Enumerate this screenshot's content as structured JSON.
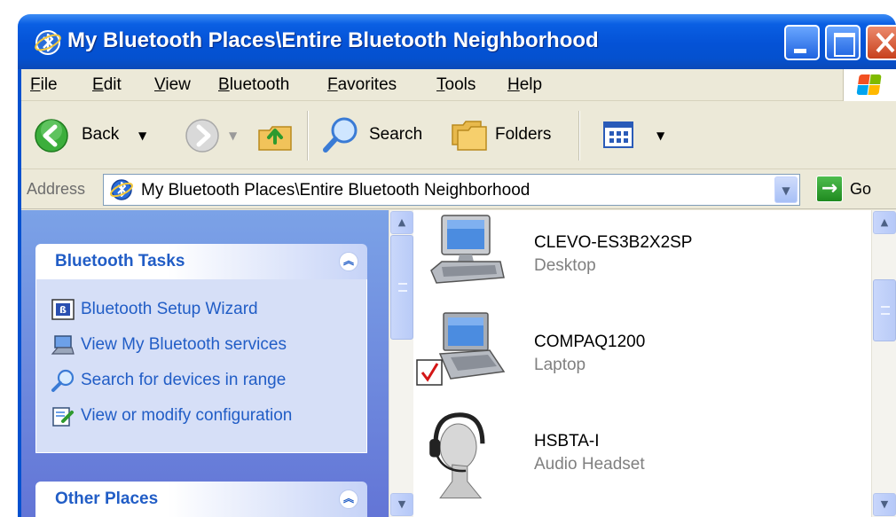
{
  "window": {
    "title": "My Bluetooth Places\\Entire Bluetooth Neighborhood"
  },
  "menu": [
    "File",
    "Edit",
    "View",
    "Bluetooth",
    "Favorites",
    "Tools",
    "Help"
  ],
  "toolbar": {
    "back_label": "Back",
    "search_label": "Search",
    "folders_label": "Folders"
  },
  "address": {
    "label": "Address",
    "value": "My Bluetooth Places\\Entire Bluetooth Neighborhood",
    "go_label": "Go"
  },
  "taskpane": {
    "bluetooth_tasks": {
      "title": "Bluetooth Tasks",
      "items": [
        {
          "label": "Bluetooth Setup Wizard",
          "icon": "setup-wizard-icon"
        },
        {
          "label": "View My Bluetooth services",
          "icon": "bluetooth-services-icon"
        },
        {
          "label": "Search for devices in range",
          "icon": "search-icon"
        },
        {
          "label": "View or modify configuration",
          "icon": "configuration-icon"
        }
      ]
    },
    "other_places": {
      "title": "Other Places"
    }
  },
  "devices": [
    {
      "name": "CLEVO-ES3B2X2SP",
      "type": "Desktop",
      "icon": "desktop-computer-icon"
    },
    {
      "name": "COMPAQ1200",
      "type": "Laptop",
      "icon": "laptop-icon",
      "checked": true
    },
    {
      "name": "HSBTA-I",
      "type": "Audio Headset",
      "icon": "headset-icon"
    }
  ],
  "colors": {
    "titlebar": "#0452d6",
    "taskpane": "#7ba2e7",
    "task_link": "#215dc6"
  }
}
